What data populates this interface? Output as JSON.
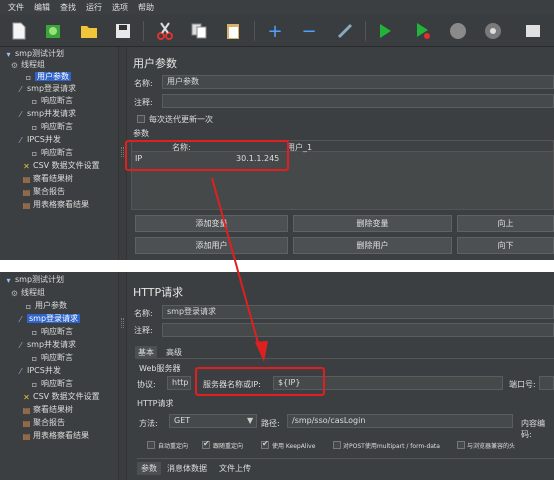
{
  "menubar": [
    "文件",
    "编辑",
    "查找",
    "运行",
    "选项",
    "帮助"
  ],
  "toolbar_icons": [
    "new-icon",
    "templates-icon",
    "open-icon",
    "save-icon",
    "cut-icon",
    "copy-icon",
    "paste-icon",
    "expand-icon",
    "collapse-icon",
    "toggle-icon",
    "start-icon",
    "start-no-pause-icon",
    "stop-icon",
    "shutdown-icon",
    "clear-icon"
  ],
  "top": {
    "tree": [
      {
        "label": "smp测试计划",
        "icon": "flask-icon"
      },
      {
        "label": "线程组",
        "icon": "gear-icon"
      },
      {
        "label": "用户参数",
        "icon": "page-icon"
      },
      {
        "label": "smp登录请求",
        "icon": "pipette-icon"
      },
      {
        "label": "响应断言",
        "icon": "page-icon"
      },
      {
        "label": "smp并发请求",
        "icon": "pipette-icon"
      },
      {
        "label": "响应断言",
        "icon": "page-icon"
      },
      {
        "label": "IPCS并发",
        "icon": "pipette-icon"
      },
      {
        "label": "响应断言",
        "icon": "page-icon"
      },
      {
        "label": "CSV 数据文件设置",
        "icon": "wrench-icon"
      },
      {
        "label": "察看结果树",
        "icon": "chart-icon"
      },
      {
        "label": "聚合报告",
        "icon": "chart-icon"
      },
      {
        "label": "用表格察看结果",
        "icon": "chart-icon"
      }
    ],
    "title": "用户参数",
    "name_label": "名称:",
    "name_value": "用户参数",
    "comment_label": "注释:",
    "checkbox_label": "每次迭代更新一次",
    "params_label": "参数",
    "table_headers": [
      "名称:",
      "用户_1"
    ],
    "table_row": [
      "IP",
      "30.1.1.245"
    ],
    "buttons": [
      "添加变量",
      "删除变量",
      "向上",
      "添加用户",
      "删除用户",
      "向下"
    ]
  },
  "bottom": {
    "tree": [
      {
        "label": "smp测试计划",
        "icon": "flask-icon"
      },
      {
        "label": "线程组",
        "icon": "gear-icon"
      },
      {
        "label": "用户参数",
        "icon": "page-icon"
      },
      {
        "label": "smp登录请求",
        "icon": "pipette-icon"
      },
      {
        "label": "响应断言",
        "icon": "page-icon"
      },
      {
        "label": "smp并发请求",
        "icon": "pipette-icon"
      },
      {
        "label": "响应断言",
        "icon": "page-icon"
      },
      {
        "label": "IPCS并发",
        "icon": "pipette-icon"
      },
      {
        "label": "响应断言",
        "icon": "page-icon"
      },
      {
        "label": "CSV 数据文件设置",
        "icon": "wrench-icon"
      },
      {
        "label": "察看结果树",
        "icon": "chart-icon"
      },
      {
        "label": "聚合报告",
        "icon": "chart-icon"
      },
      {
        "label": "用表格察看结果",
        "icon": "chart-icon"
      }
    ],
    "title": "HTTP请求",
    "name_label": "名称:",
    "name_value": "smp登录请求",
    "comment_label": "注释:",
    "tabs": [
      "基本",
      "高级"
    ],
    "web_server_label": "Web服务器",
    "protocol_label": "协议:",
    "protocol_value": "http",
    "server_label": "服务器名称或IP:",
    "server_value": "${IP}",
    "port_label": "端口号:",
    "http_request_label": "HTTP请求",
    "method_label": "方法:",
    "method_value": "GET",
    "path_label": "路径:",
    "path_value": "/smp/sso/casLogin",
    "encoding_label": "内容编码:",
    "options": [
      "自动重定向",
      "跟随重定向",
      "使用 KeepAlive",
      "对POST使用multipart / form-data",
      "与浏览器兼容的头"
    ],
    "options_checked": [
      false,
      true,
      true,
      false,
      false
    ],
    "subtabs": [
      "参数",
      "消息体数据",
      "文件上传"
    ]
  }
}
